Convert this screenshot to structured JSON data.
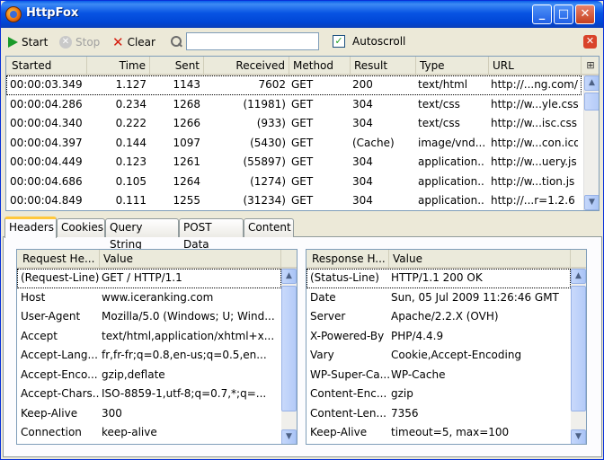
{
  "window": {
    "title": "HttpFox"
  },
  "toolbar": {
    "start_label": "Start",
    "stop_label": "Stop",
    "clear_label": "Clear",
    "search_value": "",
    "autoscroll_label": "Autoscroll",
    "autoscroll_checked": true
  },
  "requests": {
    "columns": [
      "Started",
      "Time",
      "Sent",
      "Received",
      "Method",
      "Result",
      "Type",
      "URL"
    ],
    "rows": [
      [
        "00:00:03.349",
        "1.127",
        "1143",
        "7602",
        "GET",
        "200",
        "text/html",
        "http://...ng.com/"
      ],
      [
        "00:00:04.286",
        "0.234",
        "1268",
        "(11981)",
        "GET",
        "304",
        "text/css",
        "http://w...yle.css"
      ],
      [
        "00:00:04.340",
        "0.222",
        "1266",
        "(933)",
        "GET",
        "304",
        "text/css",
        "http://w...isc.css"
      ],
      [
        "00:00:04.397",
        "0.144",
        "1097",
        "(5430)",
        "GET",
        "(Cache)",
        "image/vnd...",
        "http://w...con.ico"
      ],
      [
        "00:00:04.449",
        "0.123",
        "1261",
        "(55897)",
        "GET",
        "304",
        "application...",
        "http://w...uery.js"
      ],
      [
        "00:00:04.686",
        "0.105",
        "1264",
        "(1274)",
        "GET",
        "304",
        "application...",
        "http://w...tion.js"
      ],
      [
        "00:00:04.849",
        "0.111",
        "1255",
        "(31234)",
        "GET",
        "304",
        "application...",
        "http://...r=1.2.6"
      ]
    ]
  },
  "tabs": [
    "Headers",
    "Cookies",
    "Query String",
    "POST Data",
    "Content"
  ],
  "request_headers": {
    "columns": [
      "Request He...",
      "Value"
    ],
    "rows": [
      [
        "(Request-Line)",
        "GET / HTTP/1.1"
      ],
      [
        "Host",
        "www.iceranking.com"
      ],
      [
        "User-Agent",
        "Mozilla/5.0 (Windows; U; Wind..."
      ],
      [
        "Accept",
        "text/html,application/xhtml+x..."
      ],
      [
        "Accept-Lang...",
        "fr,fr-fr;q=0.8,en-us;q=0.5,en..."
      ],
      [
        "Accept-Enco...",
        "gzip,deflate"
      ],
      [
        "Accept-Chars...",
        "ISO-8859-1,utf-8;q=0.7,*;q=..."
      ],
      [
        "Keep-Alive",
        "300"
      ],
      [
        "Connection",
        "keep-alive"
      ]
    ]
  },
  "response_headers": {
    "columns": [
      "Response H...",
      "Value"
    ],
    "rows": [
      [
        "(Status-Line)",
        "HTTP/1.1 200 OK"
      ],
      [
        "Date",
        "Sun, 05 Jul 2009 11:26:46 GMT"
      ],
      [
        "Server",
        "Apache/2.2.X (OVH)"
      ],
      [
        "X-Powered-By",
        "PHP/4.4.9"
      ],
      [
        "Vary",
        "Cookie,Accept-Encoding"
      ],
      [
        "WP-Super-Ca...",
        "WP-Cache"
      ],
      [
        "Content-Enc...",
        "gzip"
      ],
      [
        "Content-Len...",
        "7356"
      ],
      [
        "Keep-Alive",
        "timeout=5, max=100"
      ]
    ]
  },
  "colors": {
    "titlebar": "#0854e3",
    "tab_highlight": "#ffc83c",
    "play_green": "#1a9a2a",
    "clear_red": "#d51d0f"
  },
  "icons": [
    "app-icon",
    "minimize-icon",
    "maximize-icon",
    "close-icon",
    "play-icon",
    "stop-icon",
    "clear-icon",
    "search-icon",
    "checkbox-icon",
    "panel-close-icon",
    "column-picker-icon",
    "scroll-up-icon",
    "scroll-down-icon"
  ]
}
